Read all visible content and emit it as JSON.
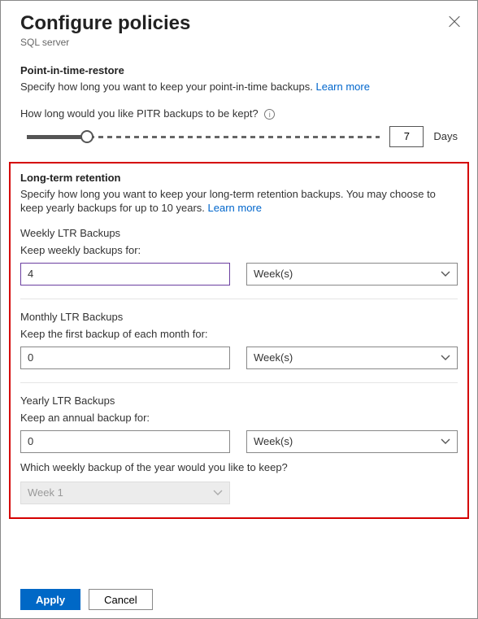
{
  "header": {
    "title": "Configure policies",
    "subtitle": "SQL server"
  },
  "pitr": {
    "section_title": "Point-in-time-restore",
    "desc_prefix": "Specify how long you want to keep your point-in-time backups. ",
    "learn_more": "Learn more",
    "question": "How long would you like PITR backups to be kept?",
    "value": "7",
    "unit": "Days"
  },
  "ltr": {
    "section_title": "Long-term retention",
    "desc_prefix": "Specify how long you want to keep your long-term retention backups. You may choose to keep yearly backups for up to 10 years. ",
    "learn_more": "Learn more",
    "weekly": {
      "title": "Weekly LTR Backups",
      "label": "Keep weekly backups for:",
      "value": "4",
      "unit": "Week(s)"
    },
    "monthly": {
      "title": "Monthly LTR Backups",
      "label": "Keep the first backup of each month for:",
      "value": "0",
      "unit": "Week(s)"
    },
    "yearly": {
      "title": "Yearly LTR Backups",
      "label": "Keep an annual backup for:",
      "value": "0",
      "unit": "Week(s)",
      "which_week_q": "Which weekly backup of the year would you like to keep?",
      "which_week_value": "Week 1"
    }
  },
  "footer": {
    "apply": "Apply",
    "cancel": "Cancel"
  }
}
